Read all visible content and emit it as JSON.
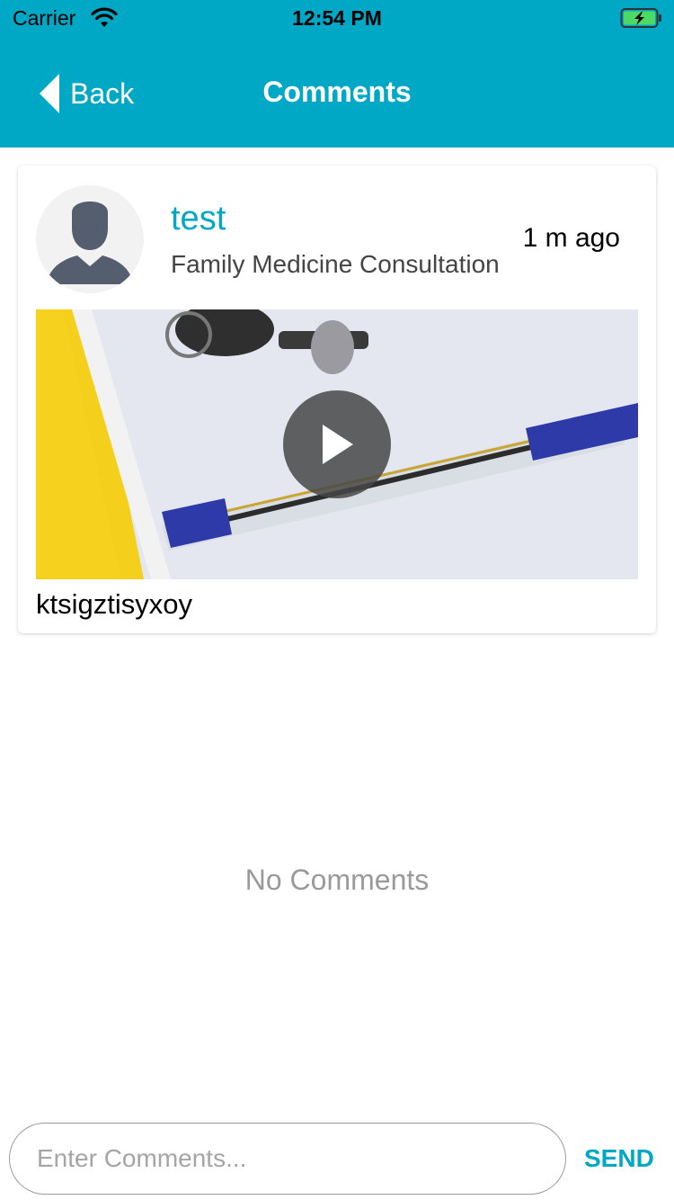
{
  "status_bar": {
    "carrier": "Carrier",
    "time": "12:54 PM"
  },
  "nav": {
    "back_label": "Back",
    "title": "Comments"
  },
  "post": {
    "author": "test",
    "subtitle": "Family Medicine Consultation",
    "time_ago": "1 m ago",
    "caption": "ktsigztisyxoy"
  },
  "comments": {
    "empty_text": "No Comments"
  },
  "composer": {
    "placeholder": "Enter Comments...",
    "value": "",
    "send_label": "SEND"
  },
  "colors": {
    "accent": "#00A8C6",
    "header_text": "#FFFFFF",
    "muted_text": "#9A9A9A"
  },
  "icons": {
    "back": "chevron-left-icon",
    "play": "play-icon",
    "wifi": "wifi-icon",
    "battery": "battery-charging-icon",
    "avatar": "user-silhouette-icon"
  }
}
